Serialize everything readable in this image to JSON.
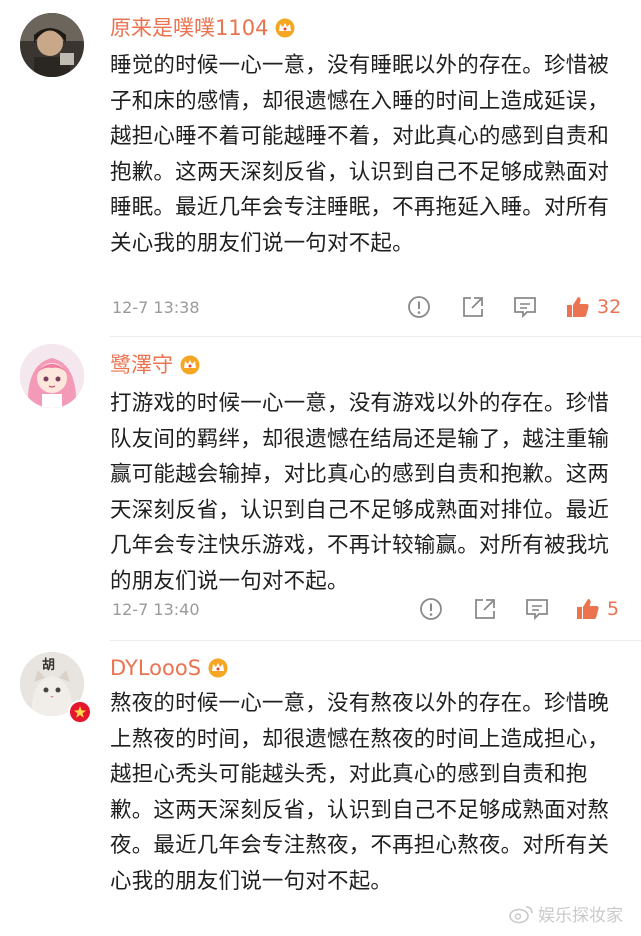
{
  "comments": [
    {
      "username": "原来是噗噗1104",
      "text": "睡觉的时候一心一意，没有睡眠以外的存在。珍惜被子和床的感情，却很遗憾在入睡的时间上造成延误，越担心睡不着可能越睡不着，对此真心的感到自责和抱歉。这两天深刻反省，认识到自己不足够成熟面对睡眠。最近几年会专注睡眠，不再拖延入睡。对所有关心我的朋友们说一句对不起。",
      "time": "12-7 13:38",
      "likes": "32"
    },
    {
      "username": "鹭澤守",
      "text": "打游戏的时候一心一意，没有游戏以外的存在。珍惜队友间的羁绊，却很遗憾在结局还是输了，越注重输赢可能越会输掉，对比真心的感到自责和抱歉。这两天深刻反省，认识到自己不足够成熟面对排位。最近几年会专注快乐游戏，不再计较输赢。对所有被我坑的朋友们说一句对不起。",
      "time": "12-7 13:40",
      "likes": "5"
    },
    {
      "username": "DYLoooS",
      "avatar_text": "胡",
      "text": "熬夜的时候一心一意，没有熬夜以外的存在。珍惜晚上熬夜的时间，却很遗憾在熬夜的时间上造成担心，越担心秃头可能越头秃，对此真心的感到自责和抱歉。这两天深刻反省，认识到自己不足够成熟面对熬夜。最近几年会专注熬夜，不再担心熬夜。对所有关心我的朋友们说一句对不起。"
    }
  ],
  "watermark": "娱乐探妆家",
  "colors": {
    "accent": "#eb7350",
    "meta": "#9a9a9a",
    "text": "#1f1f1f"
  }
}
